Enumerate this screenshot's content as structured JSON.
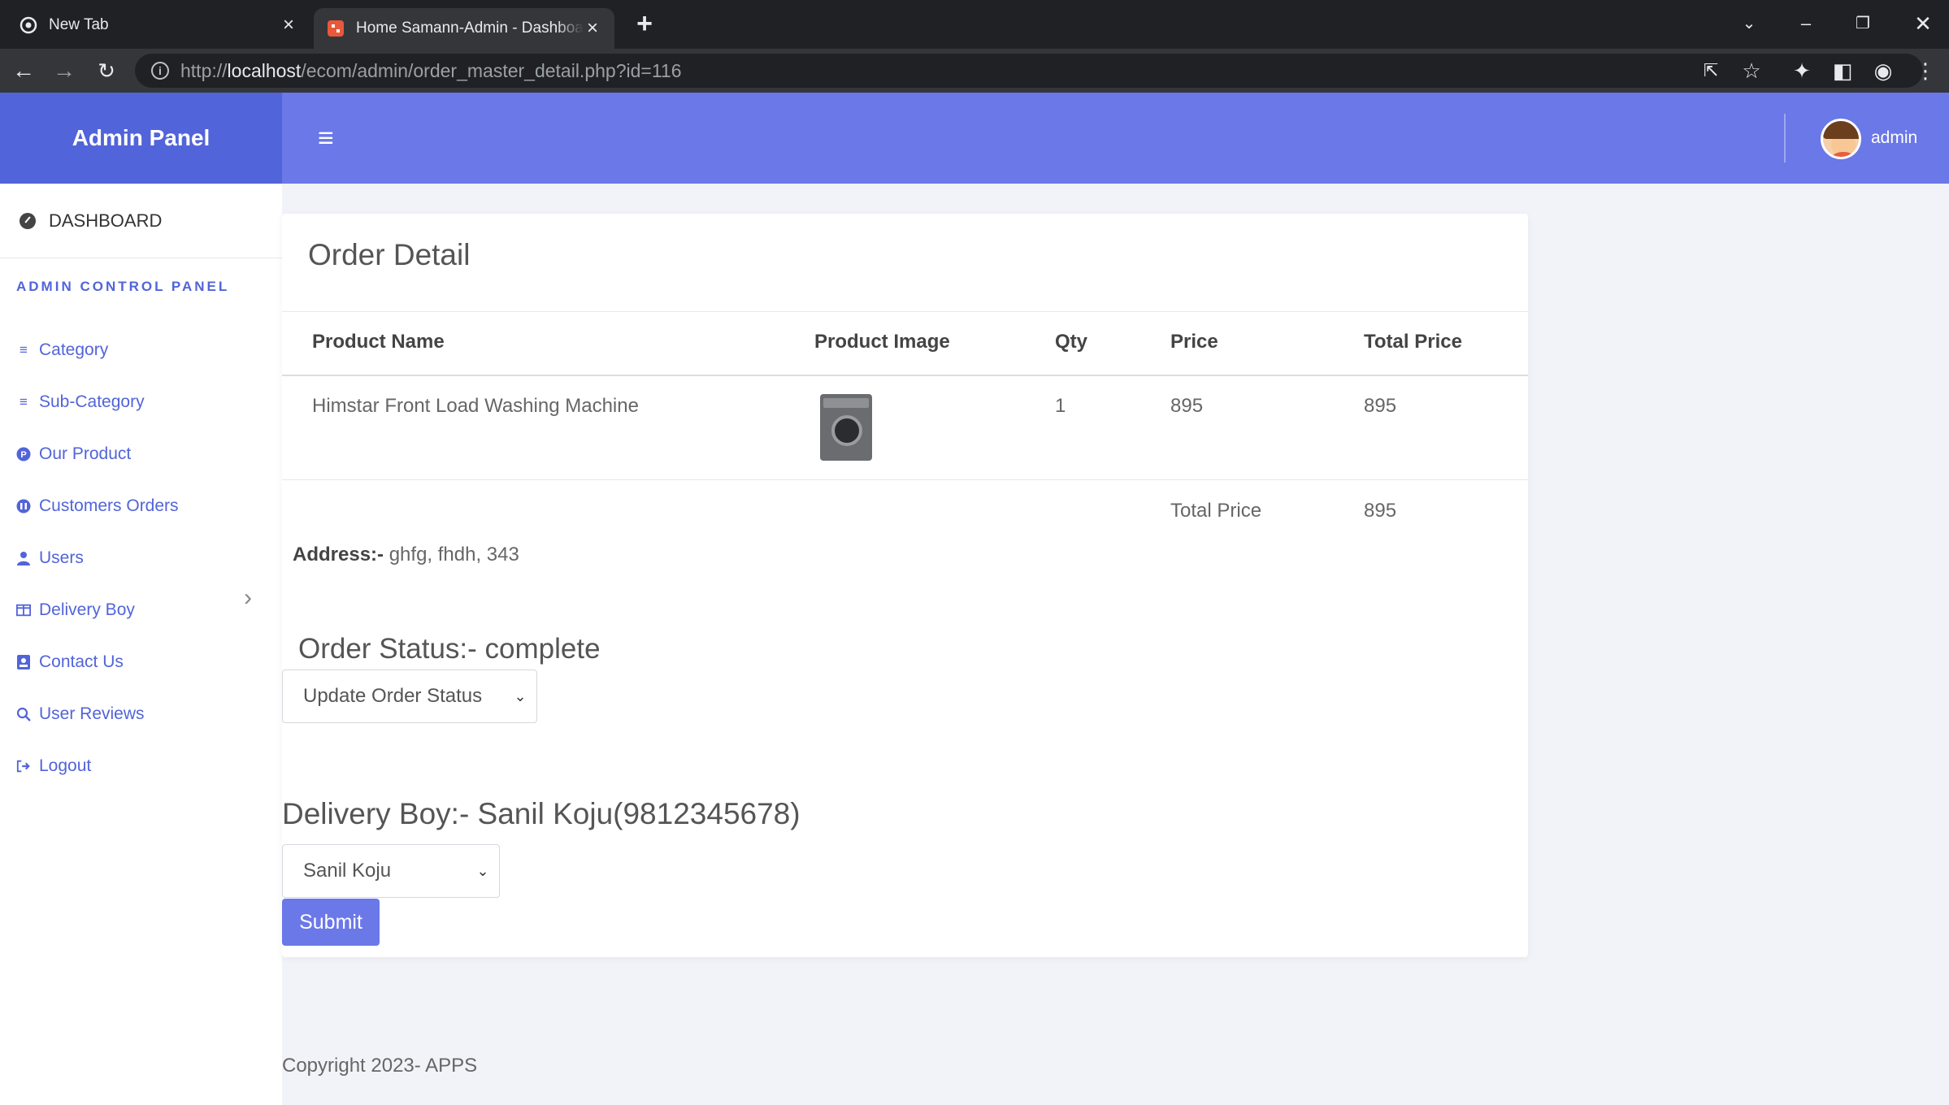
{
  "browser": {
    "tabs": [
      {
        "title": "New Tab",
        "active": false
      },
      {
        "title": "Home Samann-Admin - Dashboard",
        "active": true
      }
    ],
    "url_prefix": "http://",
    "url_host": "localhost",
    "url_path": "/ecom/admin/order_master_detail.php?id=116"
  },
  "header": {
    "brand": "Admin Panel",
    "user": "admin",
    "accent": "#6b78e8",
    "brand_color": "#5264d9"
  },
  "sidebar": {
    "dashboard": "DASHBOARD",
    "heading": "ADMIN CONTROL PANEL",
    "items": [
      {
        "label": "Category",
        "icon": "list-icon"
      },
      {
        "label": "Sub-Category",
        "icon": "list-icon"
      },
      {
        "label": "Our Product",
        "icon": "product-icon"
      },
      {
        "label": "Customers Orders",
        "icon": "orders-icon"
      },
      {
        "label": "Users",
        "icon": "user-icon"
      },
      {
        "label": "Delivery Boy",
        "icon": "table-icon"
      },
      {
        "label": "Contact Us",
        "icon": "contact-icon"
      },
      {
        "label": "User Reviews",
        "icon": "search-icon"
      },
      {
        "label": "Logout",
        "icon": "logout-icon"
      }
    ]
  },
  "order": {
    "title": "Order Detail",
    "columns": [
      "Product Name",
      "Product Image",
      "Qty",
      "Price",
      "Total Price"
    ],
    "rows": [
      {
        "name": "Himstar Front Load Washing Machine",
        "image": "washing-machine",
        "qty": "1",
        "price": "895",
        "total": "895"
      }
    ],
    "total_label": "Total Price",
    "total_value": "895",
    "address_label": "Address:-",
    "address_value": "ghfg, fhdh, 343",
    "status_title": "Order Status:- complete",
    "status_select": "Update Order Status",
    "delivery_title": "Delivery Boy:- Sanil Koju(9812345678)",
    "delivery_select": "Sanil Koju",
    "submit": "Submit"
  },
  "footer": "Copyright 2023- APPS"
}
